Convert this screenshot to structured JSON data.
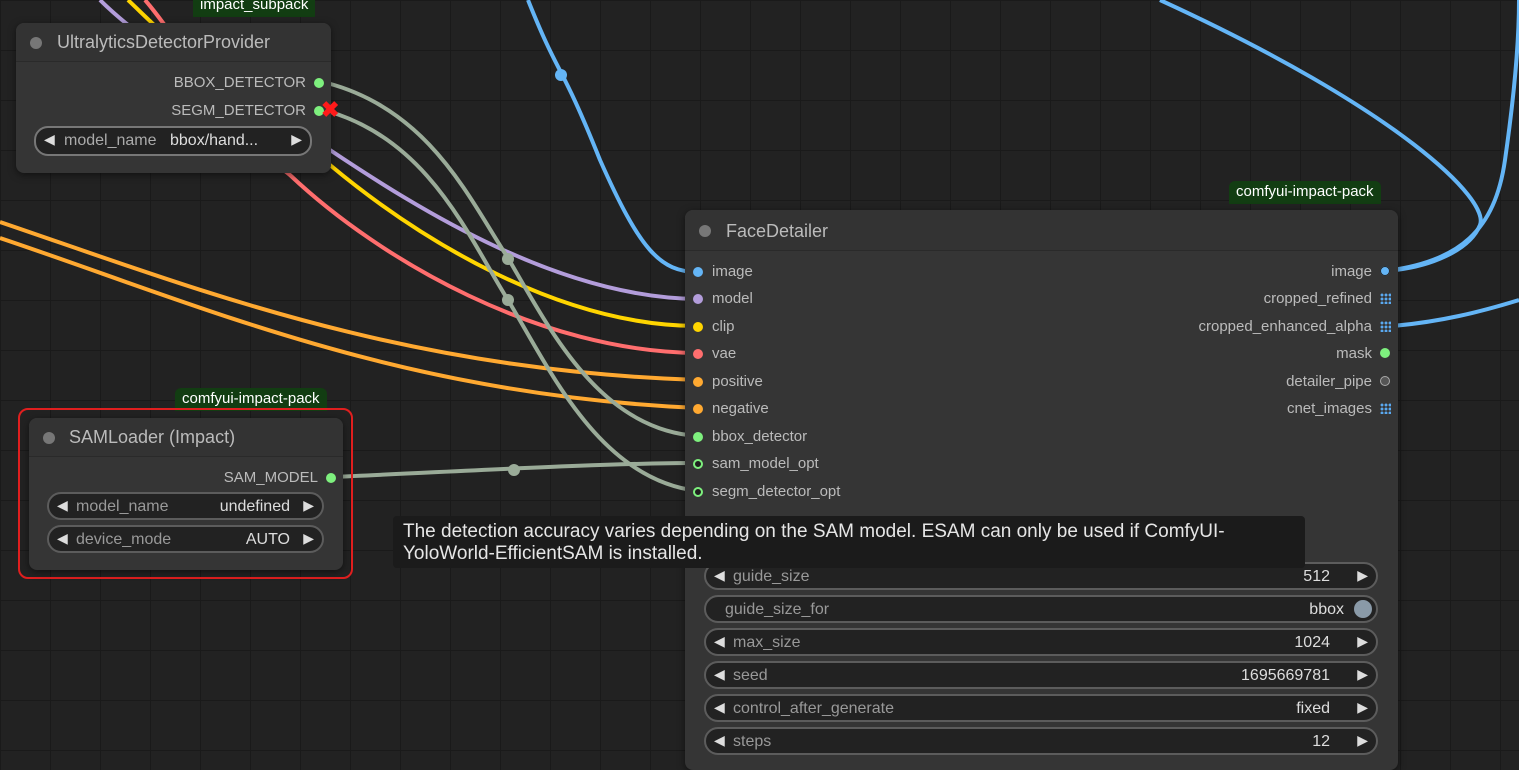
{
  "nodes": {
    "ultralytics": {
      "badge": "impact_subpack",
      "title": "UltralyticsDetectorProvider",
      "outputs": [
        "BBOX_DETECTOR",
        "SEGM_DETECTOR"
      ],
      "widget": {
        "name": "model_name",
        "value": "bbox/hand..."
      }
    },
    "samloader": {
      "badge": "comfyui-impact-pack",
      "title": "SAMLoader (Impact)",
      "output": "SAM_MODEL",
      "widgets": [
        {
          "name": "model_name",
          "value": "undefined"
        },
        {
          "name": "device_mode",
          "value": "AUTO"
        }
      ]
    },
    "facedetailer": {
      "badge": "comfyui-impact-pack",
      "title": "FaceDetailer",
      "inputs": [
        "image",
        "model",
        "clip",
        "vae",
        "positive",
        "negative",
        "bbox_detector",
        "sam_model_opt",
        "segm_detector_opt"
      ],
      "outputs": [
        "image",
        "cropped_refined",
        "cropped_enhanced_alpha",
        "mask",
        "detailer_pipe",
        "cnet_images"
      ],
      "widgets": [
        {
          "name": "guide_size",
          "value": "512"
        },
        {
          "name": "guide_size_for",
          "value": "bbox"
        },
        {
          "name": "max_size",
          "value": "1024"
        },
        {
          "name": "seed",
          "value": "1695669781"
        },
        {
          "name": "control_after_generate",
          "value": "fixed"
        },
        {
          "name": "steps",
          "value": "12"
        }
      ]
    }
  },
  "tooltip": "The detection accuracy varies depending on the SAM model. ESAM can only be used if ComfyUI-YoloWorld-EfficientSAM is installed.",
  "icons": {
    "arrow_left": "◀",
    "arrow_right": "▶",
    "remove": "✖"
  },
  "colors": {
    "image": "#64b5f6",
    "model": "#b39ddb",
    "clip": "#ffd500",
    "vae": "#ff6e6e",
    "conditioning": "#ffa931",
    "detector": "#7ef07e",
    "link_gray": "#9aab98",
    "selected_outline": "#e01f1f"
  }
}
